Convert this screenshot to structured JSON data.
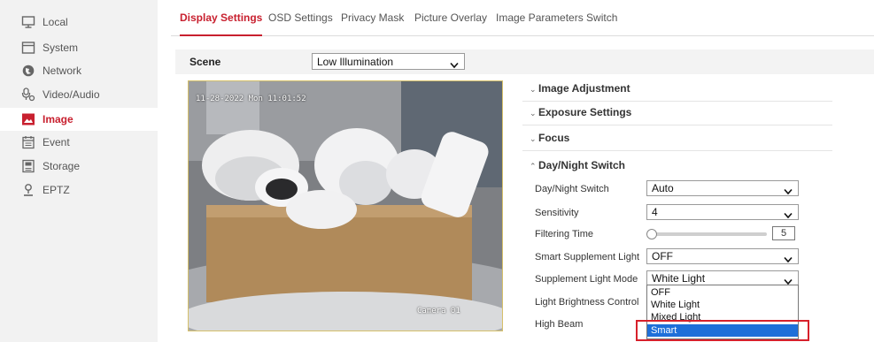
{
  "sidebar": {
    "items": [
      {
        "label": "Local",
        "icon": "monitor-icon"
      },
      {
        "label": "System",
        "icon": "system-icon"
      },
      {
        "label": "Network",
        "icon": "network-icon"
      },
      {
        "label": "Video/Audio",
        "icon": "video-audio-icon"
      },
      {
        "label": "Image",
        "icon": "image-icon",
        "active": true
      },
      {
        "label": "Event",
        "icon": "event-icon"
      },
      {
        "label": "Storage",
        "icon": "storage-icon"
      },
      {
        "label": "EPTZ",
        "icon": "eptz-icon"
      }
    ]
  },
  "tabs": [
    {
      "label": "Display Settings",
      "active": true
    },
    {
      "label": "OSD Settings"
    },
    {
      "label": "Privacy Mask"
    },
    {
      "label": "Picture Overlay"
    },
    {
      "label": "Image Parameters Switch"
    }
  ],
  "scene": {
    "label": "Scene",
    "value": "Low Illumination"
  },
  "video": {
    "osd_datetime": "11-28-2022 Mon 11:01:52",
    "osd_camera": "Camera 01"
  },
  "sections": {
    "image_adjustment": "Image Adjustment",
    "exposure_settings": "Exposure Settings",
    "focus": "Focus",
    "day_night_switch": "Day/Night Switch"
  },
  "day_night": {
    "mode_label": "Day/Night Switch",
    "mode_value": "Auto",
    "sensitivity_label": "Sensitivity",
    "sensitivity_value": "4",
    "filtering_time_label": "Filtering Time",
    "filtering_time_value": "5",
    "smart_supplement_light_label": "Smart Supplement Light",
    "smart_supplement_light_value": "OFF",
    "supplement_light_mode_label": "Supplement Light Mode",
    "supplement_light_mode_value": "White Light",
    "light_brightness_control_label": "Light Brightness Control",
    "high_beam_label": "High Beam"
  },
  "supplement_light_options": [
    "OFF",
    "White Light",
    "Mixed Light",
    "Smart"
  ],
  "selected_option": "Smart",
  "colors": {
    "accent": "#c8202f",
    "highlight_box": "#d7202b",
    "selection": "#1e6fd9"
  }
}
